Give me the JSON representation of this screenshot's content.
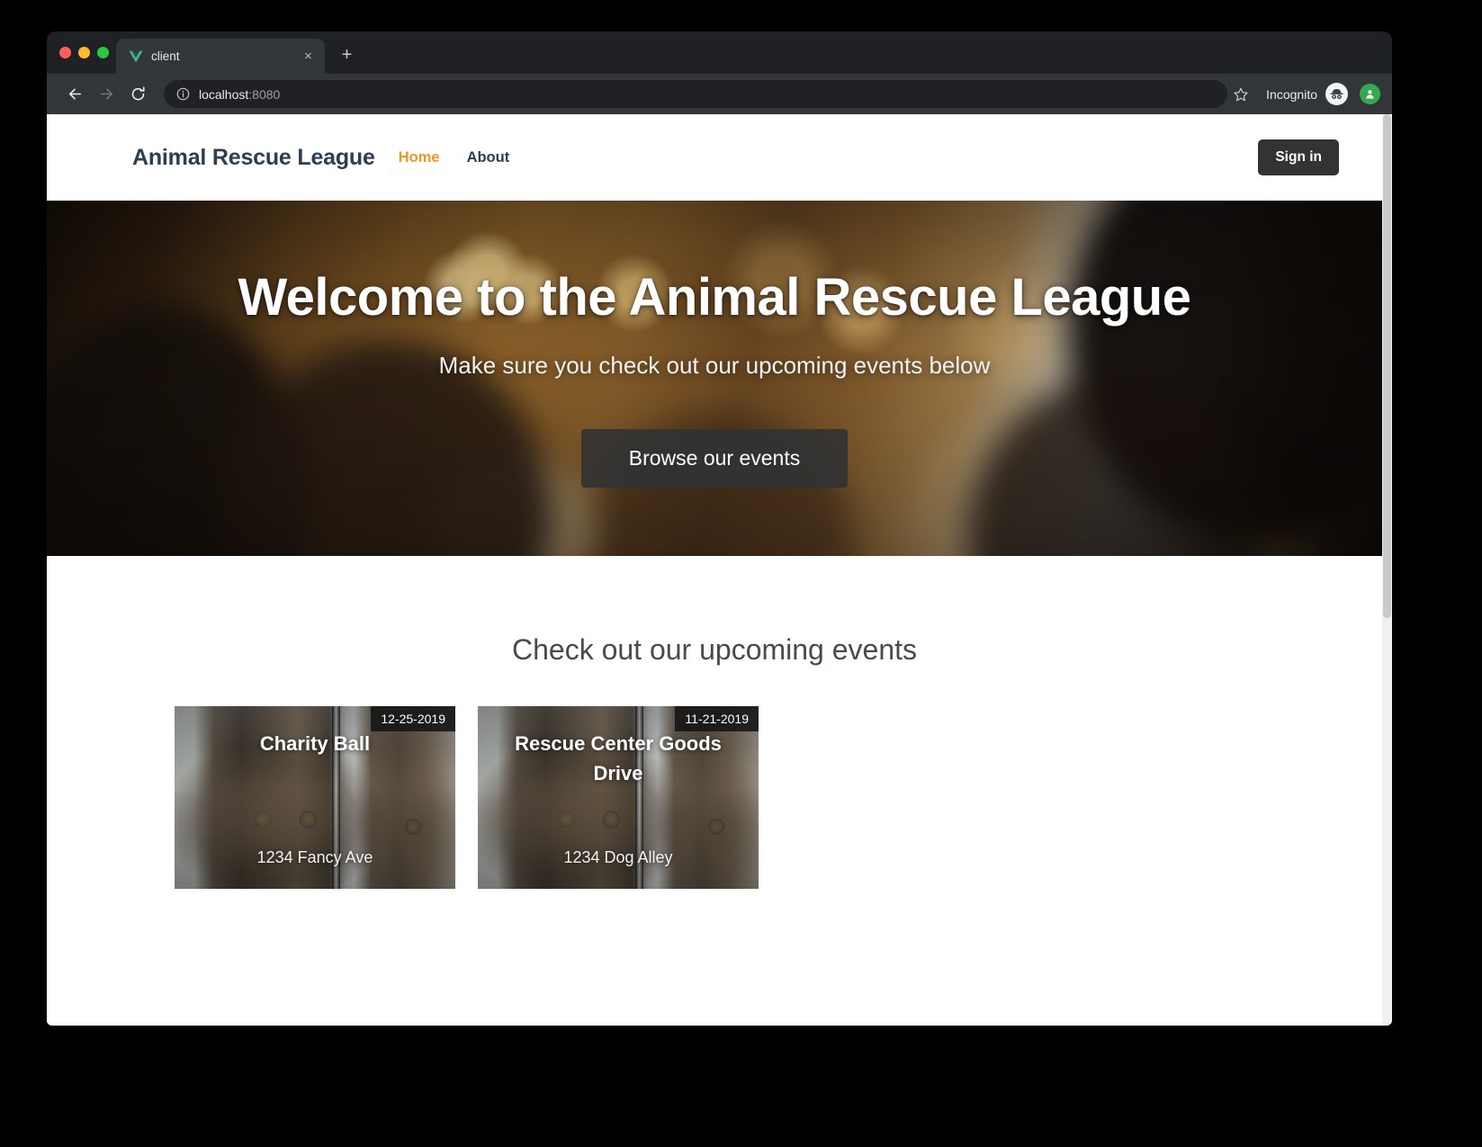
{
  "browser": {
    "tab": {
      "title": "client",
      "favicon": "vue-logo-icon",
      "close_label": "×"
    },
    "new_tab_label": "+",
    "toolbar": {
      "back_icon": "back-arrow-icon",
      "forward_icon": "forward-arrow-icon",
      "reload_icon": "reload-icon",
      "site_info_icon": "info-circle-icon",
      "url_prefix": "localhost",
      "url_suffix": ":8080",
      "bookmark_icon": "star-icon",
      "incognito_label": "Incognito",
      "incognito_icon": "incognito-hat-icon",
      "profile_icon": "profile-avatar-icon"
    }
  },
  "site": {
    "brand": "Animal Rescue League",
    "nav_links": [
      {
        "label": "Home",
        "active": true
      },
      {
        "label": "About",
        "active": false
      }
    ],
    "signin_label": "Sign in"
  },
  "hero": {
    "title": "Welcome to the Animal Rescue League",
    "subtitle": "Make sure you check out our upcoming events below",
    "cta_label": "Browse our events"
  },
  "events": {
    "heading": "Check out our upcoming events",
    "cards": [
      {
        "title": "Charity Ball",
        "date": "12-25-2019",
        "address": "1234 Fancy Ave",
        "image": "kitten-photo"
      },
      {
        "title": "Rescue Center Goods Drive",
        "date": "11-21-2019",
        "address": "1234 Dog Alley",
        "image": "kitten-photo"
      }
    ]
  },
  "colors": {
    "accent_orange": "#f0932b",
    "brand_navy": "#2c3e50",
    "button_dark": "#333333",
    "browser_chrome": "#323639",
    "browser_dark": "#202124"
  }
}
